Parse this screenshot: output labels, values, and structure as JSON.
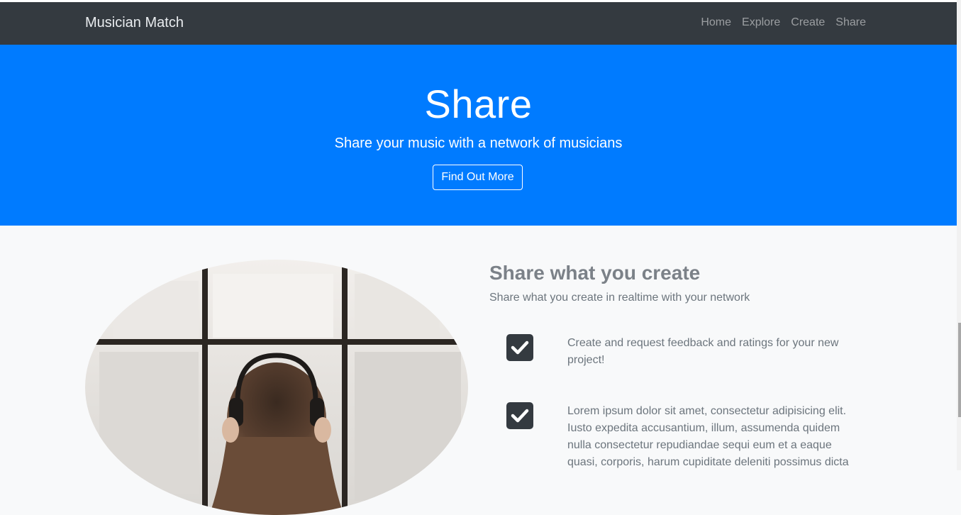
{
  "navbar": {
    "brand": "Musician Match",
    "links": [
      "Home",
      "Explore",
      "Create",
      "Share"
    ]
  },
  "hero": {
    "title": "Share",
    "subtitle": "Share your music with a network of musicians",
    "button_label": "Find Out More"
  },
  "feature": {
    "title": "Share what you create",
    "subtitle": "Share what you create in realtime with your network",
    "items": [
      {
        "icon": "checkbox-checked-icon",
        "text": "Create and request feedback and ratings for your new project!"
      },
      {
        "icon": "checkbox-checked-icon",
        "text": "Lorem ipsum dolor sit amet, consectetur adipisicing elit. Iusto expedita accusantium, illum, assumenda quidem nulla consectetur repudiandae sequi eum et a eaque quasi, corporis, harum cupiditate deleniti possimus dicta"
      }
    ]
  },
  "colors": {
    "navbar_bg": "#343a40",
    "hero_bg": "#007bff",
    "section_bg": "#f8f9fa",
    "check_bg": "#343a40"
  }
}
